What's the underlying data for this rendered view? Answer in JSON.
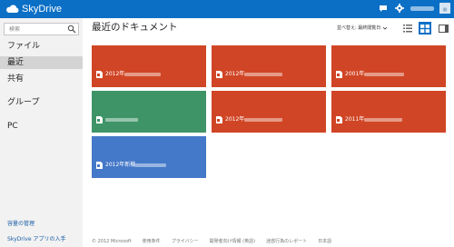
{
  "app": {
    "name": "SkyDrive"
  },
  "search": {
    "placeholder": "検索"
  },
  "sidebar": {
    "items": [
      {
        "label": "ファイル"
      },
      {
        "label": "最近"
      },
      {
        "label": "共有"
      },
      {
        "label": "グループ"
      },
      {
        "label": "PC"
      }
    ],
    "selected": "最近",
    "links": [
      {
        "label": "容量の管理"
      },
      {
        "label": "SkyDrive アプリの入手"
      }
    ]
  },
  "main": {
    "title": "最近のドキュメント",
    "sort_label": "並べ替え: 最終閲覧日",
    "tiles": [
      {
        "label": "2012年",
        "color": "#d04525",
        "app": "powerpoint"
      },
      {
        "label": "2012年",
        "color": "#d04525",
        "app": "powerpoint"
      },
      {
        "label": "2001年",
        "color": "#d04525",
        "app": "powerpoint"
      },
      {
        "label": "",
        "color": "#3f9467",
        "app": "excel"
      },
      {
        "label": "2012年",
        "color": "#d04525",
        "app": "powerpoint"
      },
      {
        "label": "2011年",
        "color": "#d04525",
        "app": "powerpoint"
      },
      {
        "label": "2012年新機",
        "color": "#4478c8",
        "app": "word"
      }
    ]
  },
  "footer": {
    "links": [
      {
        "label": "© 2012 Microsoft"
      },
      {
        "label": "使用条件"
      },
      {
        "label": "プライバシー"
      },
      {
        "label": "開発者向け情報 (英語)"
      },
      {
        "label": "迷惑行為のレポート"
      },
      {
        "label": "日本語"
      }
    ]
  },
  "colors": {
    "topbar": "#0b6fc6",
    "sidebar_bg": "#f2f2f2",
    "selected_nav": "#d4d4d4",
    "powerpoint_tile": "#d04525",
    "excel_tile": "#3f9467",
    "word_tile": "#4478c8",
    "link": "#1a5ea7"
  },
  "icons": [
    "skydrive-cloud-icon",
    "chat-icon",
    "settings-gear-icon",
    "avatar",
    "search-icon",
    "details-view-icon",
    "thumbnails-view-icon",
    "preview-pane-icon",
    "document-icon",
    "chevron-down-icon"
  ]
}
